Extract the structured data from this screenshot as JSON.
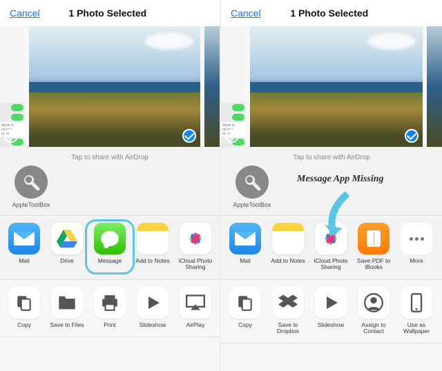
{
  "left": {
    "header": {
      "cancel": "Cancel",
      "title": "1 Photo Selected"
    },
    "airdrop_hint": "Tap to share with AirDrop",
    "airdrop": {
      "label": "AppleToolBox"
    },
    "share_row": [
      {
        "name": "mail",
        "label": "Mail"
      },
      {
        "name": "drive",
        "label": "Drive"
      },
      {
        "name": "message",
        "label": "Message",
        "highlighted": true
      },
      {
        "name": "add-to-notes",
        "label": "Add to Notes"
      },
      {
        "name": "icloud-photo-sharing",
        "label": "iCloud Photo Sharing"
      }
    ],
    "action_row": [
      {
        "name": "copy",
        "label": "Copy"
      },
      {
        "name": "save-to-files",
        "label": "Save to Files"
      },
      {
        "name": "print",
        "label": "Print"
      },
      {
        "name": "slideshow",
        "label": "Slideshow"
      },
      {
        "name": "airplay",
        "label": "AirPlay"
      }
    ]
  },
  "right": {
    "header": {
      "cancel": "Cancel",
      "title": "1 Photo Selected"
    },
    "airdrop_hint": "Tap to share with AirDrop",
    "airdrop": {
      "label": "AppleToolBox"
    },
    "annotation": "Message App Missing",
    "share_row": [
      {
        "name": "mail",
        "label": "Mail"
      },
      {
        "name": "add-to-notes",
        "label": "Add to Notes"
      },
      {
        "name": "icloud-photo-sharing",
        "label": "iCloud Photo Sharing"
      },
      {
        "name": "save-pdf-ibooks",
        "label": "Save PDF to iBooks"
      },
      {
        "name": "more",
        "label": "More"
      }
    ],
    "action_row": [
      {
        "name": "copy",
        "label": "Copy"
      },
      {
        "name": "save-to-dropbox",
        "label": "Save to Dropbox"
      },
      {
        "name": "slideshow",
        "label": "Slideshow"
      },
      {
        "name": "assign-to-contact",
        "label": "Assign to Contact"
      },
      {
        "name": "use-as-wallpaper",
        "label": "Use as Wallpaper"
      }
    ]
  }
}
